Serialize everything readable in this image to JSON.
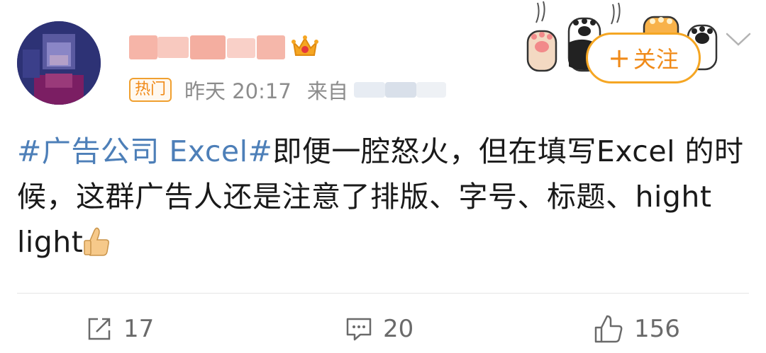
{
  "post": {
    "hot_badge": "热门",
    "time": "昨天 20:17",
    "source_label": "来自",
    "follow_label": "关注",
    "follow_plus": "+",
    "hashtag": "#广告公司 Excel#",
    "text": "即便一腔怒火，但在填写Excel 的时候，这群广告人还是注意了排版、字号、标题、hight light"
  },
  "actions": {
    "repost_count": "17",
    "comment_count": "20",
    "like_count": "156"
  },
  "colors": {
    "hashtag": "#4d7fb8",
    "accent": "#f5a623",
    "meta_gray": "#8c8c8c"
  },
  "icons": [
    "crown-icon",
    "repost-icon",
    "comment-icon",
    "like-icon",
    "thumbs-up-emoji",
    "chevron-down-icon"
  ]
}
